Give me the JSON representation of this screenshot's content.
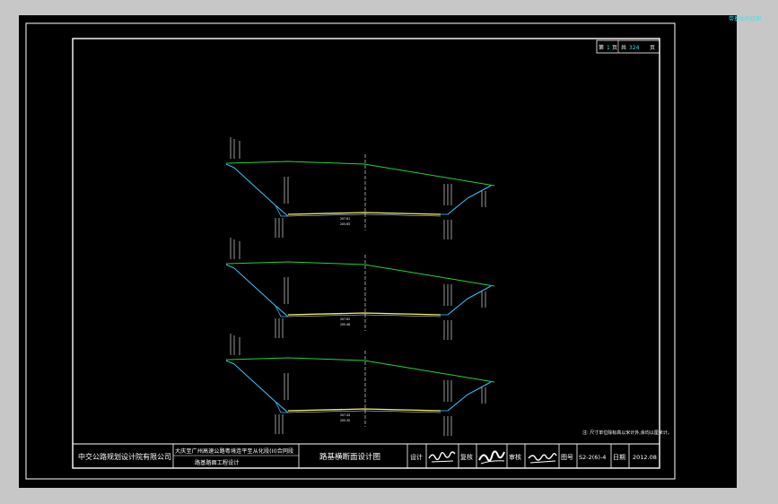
{
  "window": {
    "tag": "带基本的绘图"
  },
  "page_box": {
    "sheet_label": "第",
    "sheet_no": "1",
    "sheet_unit": "页",
    "total_label": "共",
    "total_no": "324",
    "total_unit": "页"
  },
  "note": "注: 尺寸单位除标高以米计外,余均以厘米计。",
  "title_block": {
    "company": "中交公路规划设计院有限公司",
    "project_line1": "大庆至广州高速公路粤境连平至从化段(II)合同段",
    "project_line2": "路基路面工程设计",
    "drawing_title": "路基横断面设计图",
    "design_label": "设计",
    "check_label": "复核",
    "review_label": "审核",
    "drawing_no_label": "图号",
    "drawing_no": "S2-2(6)-4",
    "date_label": "日期",
    "date": "2012.08"
  },
  "sections": [
    {
      "center_elev_a": "207.81 ",
      "center_elev_b": "205.65 "
    },
    {
      "center_elev_a": "207.62 ",
      "center_elev_b": "205.48 "
    },
    {
      "center_elev_a": "207.44 ",
      "center_elev_b": "205.30 "
    }
  ],
  "colors": {
    "sheet": "#000000",
    "frame": "#ffffff",
    "ground": "#22d43a",
    "slope": "#3ec8ff",
    "pavement": "#f0f07a",
    "centerline": "#ffffff"
  },
  "icons": [
    "designer-signature",
    "checker-signature",
    "reviewer-signature"
  ]
}
